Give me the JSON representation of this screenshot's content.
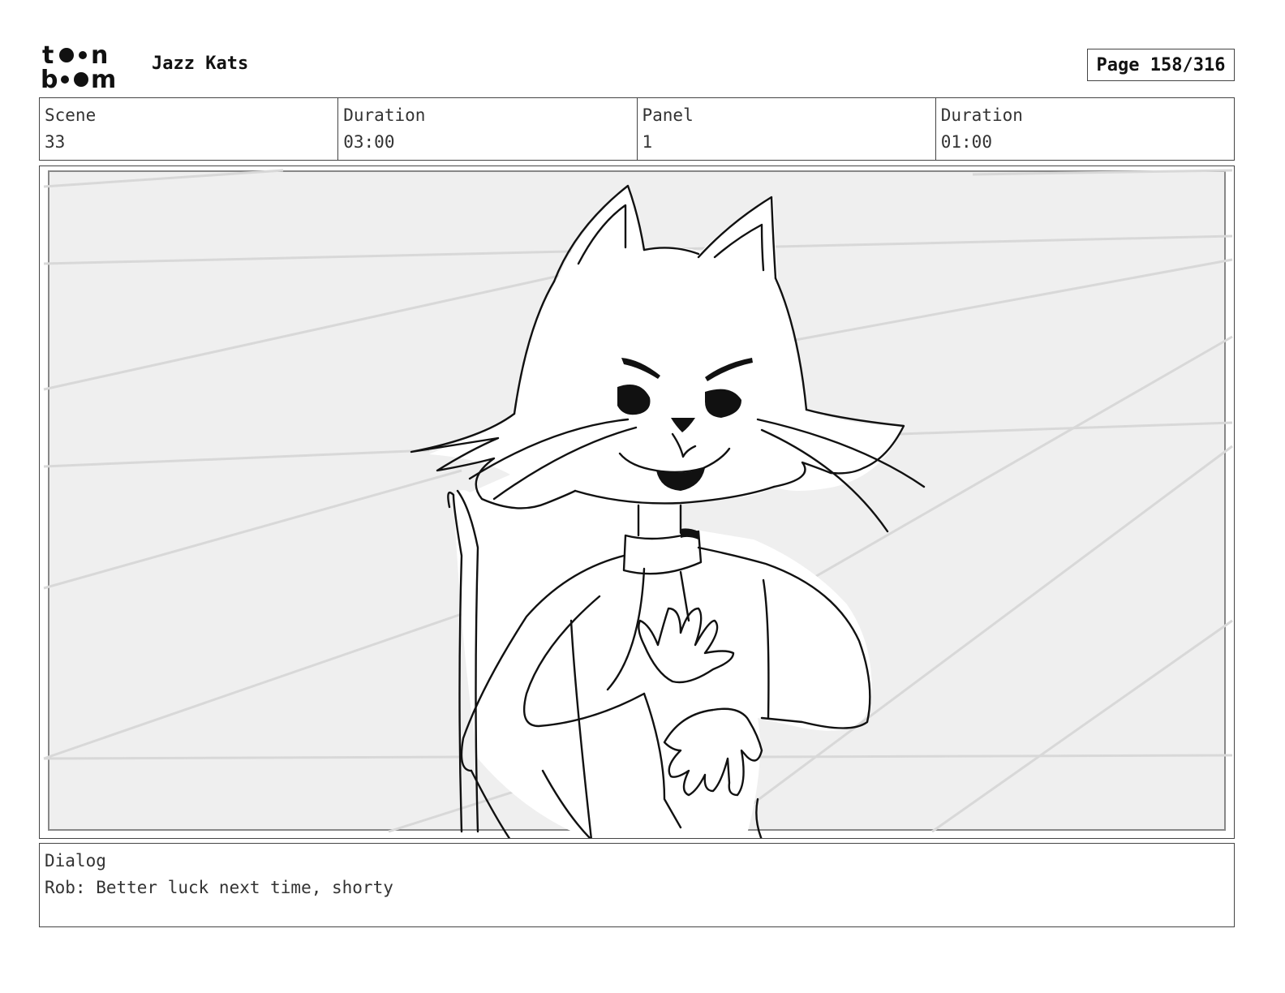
{
  "header": {
    "logo": {
      "line1": "toon",
      "line2": "boom"
    },
    "project_title": "Jazz Kats",
    "page_indicator": "Page 158/316"
  },
  "info": {
    "scene_label": "Scene",
    "scene_value": "33",
    "scene_duration_label": "Duration",
    "scene_duration_value": "03:00",
    "panel_label": "Panel",
    "panel_value": "1",
    "panel_duration_label": "Duration",
    "panel_duration_value": "01:00"
  },
  "panel": {
    "image_subject": "cat-character-sketch",
    "background_color": "#efefef",
    "line_color": "#111111"
  },
  "dialog": {
    "label": "Dialog",
    "text": "Rob: Better luck next time, shorty"
  }
}
